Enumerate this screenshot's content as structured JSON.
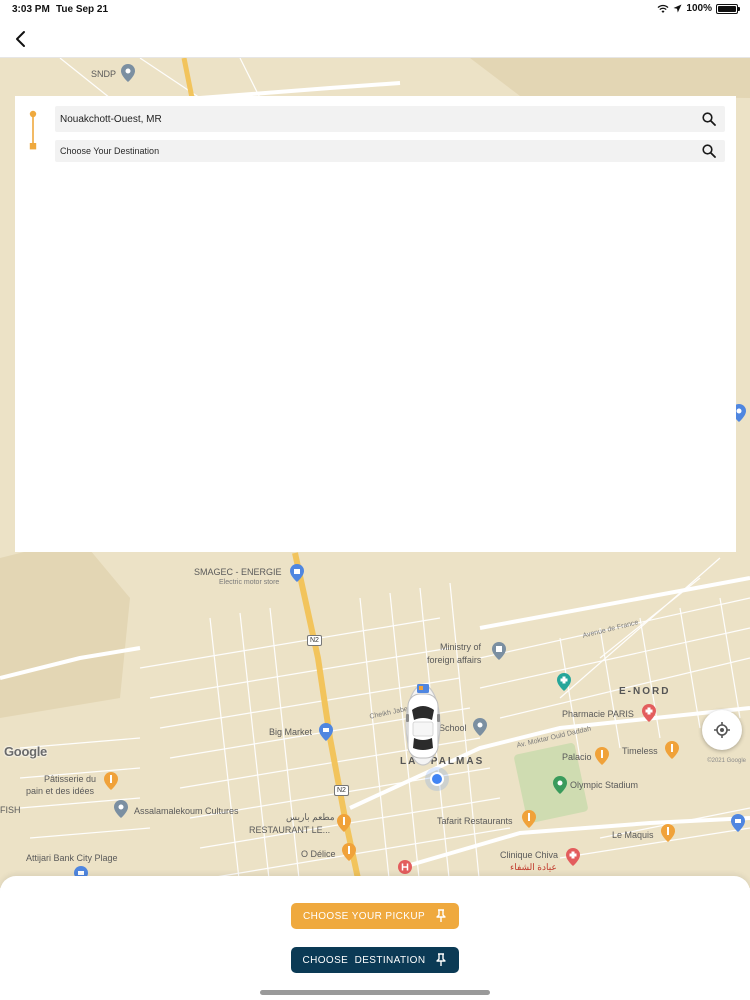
{
  "status_bar": {
    "time": "3:03 PM",
    "date": "Tue Sep 21",
    "battery": "100%"
  },
  "nav": {
    "back_icon": "chevron-left-icon"
  },
  "search": {
    "pickup_value": "Nouakchott-Ouest, MR",
    "destination_placeholder": "Choose Your Destination",
    "search_icon": "magnifier-icon"
  },
  "map": {
    "labels": {
      "sndp": "SNDP",
      "smagec": "SMAGEC - ENERGIE",
      "smagec_sub": "Electric motor store",
      "ministry_1": "Ministry of",
      "ministry_2": "foreign affairs",
      "avenue_france": "Avenue de France",
      "e_nord": "E-NORD",
      "pharmacie": "Pharmacie PARIS",
      "big_market": "Big Market",
      "school": "School",
      "cheikh": "Cheikh Jaber Al Ahm",
      "av_moktar": "Av. Moktar Ould Daddah",
      "timeless": "Timeless",
      "las_palmas": "LAS PALMAS",
      "palacio": "Palacio",
      "olympic": "Olympic Stadium",
      "patisserie_1": "Pâtisserie du",
      "patisserie_2": "pain et des idées",
      "fish": "FISH",
      "assalam": "Assalamalekoum Cultures",
      "restaurant_arabic": "مطعم باريس",
      "restaurant_le": "RESTAURANT LE...",
      "tafarit": "Tafarit Restaurants",
      "le_maquis": "Le Maquis",
      "o_delice": "O Délice",
      "clinique": "Clinique Chiva",
      "clinique_arabic": "عيادة الشفاء",
      "attijari": "Attijari Bank City Plage",
      "road_n2_a": "N2",
      "road_n2_b": "N2",
      "google": "Google",
      "copyright": "©2021 Google"
    }
  },
  "actions": {
    "pickup_label": "CHOOSE YOUR PICKUP",
    "destination_label": "CHOOSE  DESTINATION"
  },
  "colors": {
    "pickup_button": "#efa93e",
    "destination_button": "#0b3a55",
    "route_marker": "#efa93e",
    "map_land": "#ece2c6",
    "major_road": "#f2c45c",
    "user_location": "#4285f4"
  }
}
